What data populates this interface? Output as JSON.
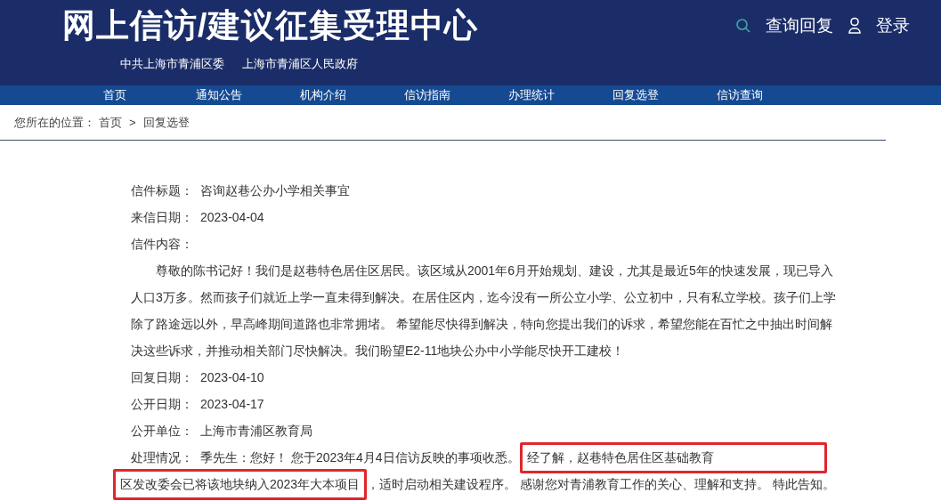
{
  "header": {
    "title": "网上信访/建议征集受理中心",
    "subtitles": [
      "中共上海市青浦区委",
      "上海市青浦区人民政府"
    ],
    "actions": [
      {
        "kind": "search",
        "label": "查询回复"
      },
      {
        "kind": "user",
        "label": "登录"
      }
    ]
  },
  "nav": [
    {
      "label": "首页",
      "selected": false
    },
    {
      "label": "通知公告",
      "selected": false
    },
    {
      "label": "机构介绍",
      "selected": false
    },
    {
      "label": "信访指南",
      "selected": false
    },
    {
      "label": "办理统计",
      "selected": false
    },
    {
      "label": "回复选登",
      "selected": false
    },
    {
      "label": "信访查询",
      "selected": false
    }
  ],
  "breadcrumb": {
    "prefix": "您所在的位置：",
    "items": [
      "首页",
      "回复选登"
    ],
    "separator": ">"
  },
  "fields_before": [
    {
      "label": "信件标题：",
      "value": "咨询赵巷公办小学相关事宜"
    },
    {
      "label": "来信日期：",
      "value": "2023-04-04"
    },
    {
      "label": "信件内容："
    }
  ],
  "content": "尊敬的陈书记好！我们是赵巷特色居住区居民。该区域从2001年6月开始规划、建设，尤其是最近5年的快速发展，现已导入人口3万多。然而孩子们就近上学一直未得到解决。在居住区内，迄今没有一所公立小学、公立初中，只有私立学校。孩子们上学除了路途远以外，早高峰期间道路也非常拥堵。 希望能尽快得到解决，特向您提出我们的诉求，希望您能在百忙之中抽出时间解决这些诉求，并推动相关部门尽快解决。我们盼望E2-11地块公办中小学能尽快开工建校！",
  "fields_after": [
    {
      "label": "回复日期：",
      "value": "2023-04-10"
    },
    {
      "label": "公开日期：",
      "value": "2023-04-17"
    },
    {
      "label": "公开单位：",
      "value": "上海市青浦区教育局"
    }
  ],
  "reply": {
    "label": "处理情况：",
    "lines": [
      [
        {
          "text": "季先生：您好！ 您于2023年4月4日信访反映的事项收悉。",
          "highlighted": false
        },
        {
          "text": "经了解，赵巷特色居住区基础教育",
          "highlighted": true
        }
      ],
      [
        {
          "text": "区发改委会已将该地块纳入2023年大本项目",
          "highlighted": true
        },
        {
          "text": "，适时启动相关建设程序。 感谢您对青浦教育工作的关心、理解和支持。 特此告知。",
          "highlighted": false
        }
      ]
    ]
  }
}
